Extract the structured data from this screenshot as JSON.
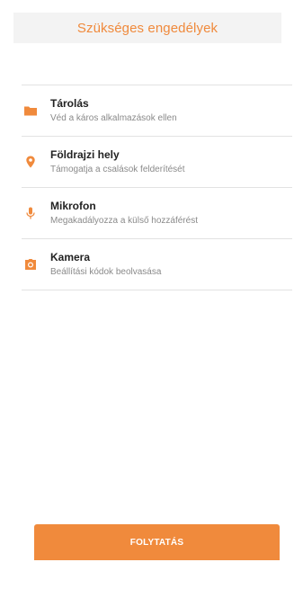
{
  "header": {
    "title": "Szükséges engedélyek"
  },
  "permissions": [
    {
      "icon": "folder-icon",
      "title": "Tárolás",
      "description": "Véd a káros alkalmazások ellen"
    },
    {
      "icon": "location-pin-icon",
      "title": "Földrajzi hely",
      "description": "Támogatja a csalások felderítését"
    },
    {
      "icon": "microphone-icon",
      "title": "Mikrofon",
      "description": "Megakadályozza a külső hozzáférést"
    },
    {
      "icon": "camera-icon",
      "title": "Kamera",
      "description": "Beállítási kódok beolvasása"
    }
  ],
  "footer": {
    "continue_label": "FOLYTATÁS"
  },
  "colors": {
    "accent": "#f08a3c",
    "title_text": "#222222",
    "description_text": "#8a8a8a",
    "header_background": "#f3f3f3",
    "divider": "#e2e2e2"
  }
}
